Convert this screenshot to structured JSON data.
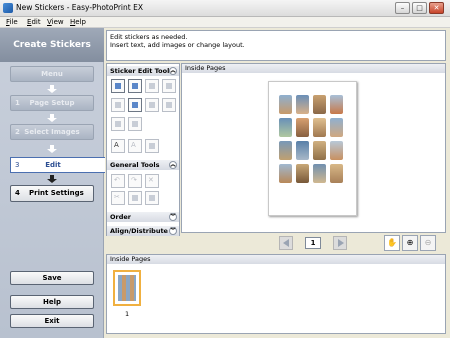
{
  "window": {
    "title": "New Stickers - Easy-PhotoPrint EX"
  },
  "menu": [
    "File",
    "Edit",
    "View",
    "Help"
  ],
  "left_panel": {
    "header": "Create Stickers",
    "steps": [
      {
        "num": "",
        "label": "Menu"
      },
      {
        "num": "1",
        "label": "Page Setup"
      },
      {
        "num": "2",
        "label": "Select Images"
      },
      {
        "num": "3",
        "label": "Edit"
      },
      {
        "num": "4",
        "label": "Print Settings"
      }
    ],
    "save_label": "Save",
    "help_label": "Help",
    "exit_label": "Exit"
  },
  "instructions": [
    "Edit stickers as needed.",
    "Insert text, add images or change layout."
  ],
  "tools": {
    "sticker_edit_title": "Sticker Edit Tools",
    "general_title": "General Tools",
    "order_label": "Order",
    "align_label": "Align/Distribute"
  },
  "inside_pages": {
    "title": "Inside Pages",
    "page_number": "1"
  },
  "thumbnails": {
    "title": "Inside Pages",
    "items": [
      {
        "label": "1"
      }
    ]
  },
  "colors": {
    "accent": "#4b6fb0",
    "thumb_selected": "#f0b040",
    "panel": "#b8c1cf"
  }
}
